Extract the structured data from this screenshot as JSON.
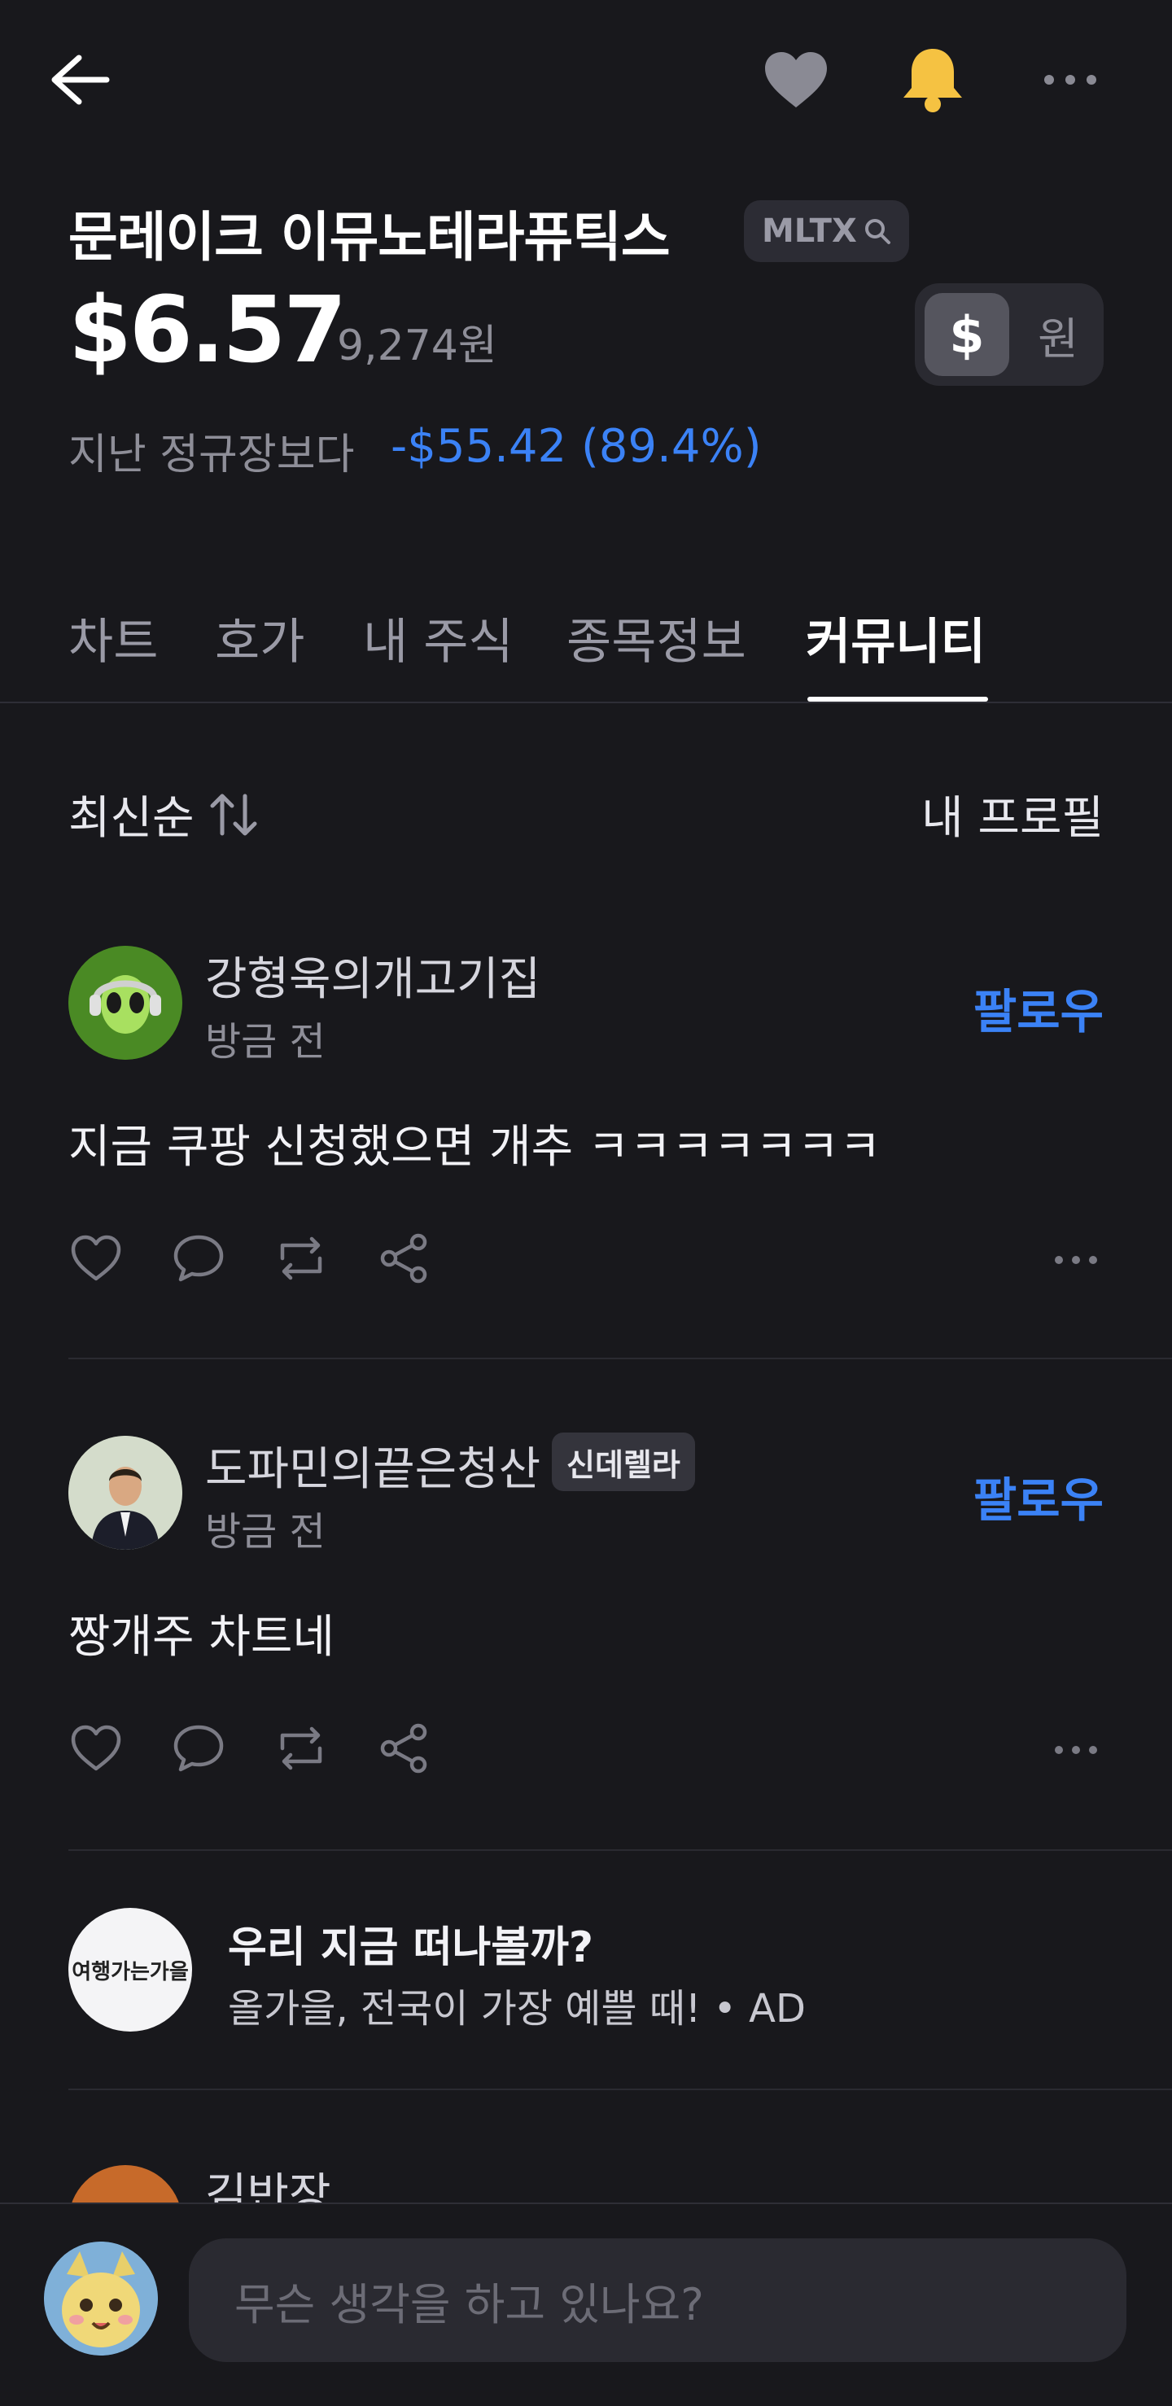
{
  "header": {
    "back_icon": "arrow-left-icon",
    "favorite_icon": "heart-icon",
    "notify_icon": "bell-icon",
    "more_icon": "more-horizontal-icon"
  },
  "stock": {
    "name": "문레이크 이뮤노테라퓨틱스",
    "ticker": "MLTX",
    "price": "$6.57",
    "price_krw": "9,274원",
    "currency_dollar": "$",
    "currency_won": "원",
    "change_label": "지난 정규장보다",
    "change_value": "-$55.42 (89.4%)"
  },
  "tabs": [
    {
      "label": "차트",
      "active": false
    },
    {
      "label": "호가",
      "active": false
    },
    {
      "label": "내 주식",
      "active": false
    },
    {
      "label": "종목정보",
      "active": false
    },
    {
      "label": "커뮤니티",
      "active": true
    }
  ],
  "sort": {
    "label": "최신순",
    "profile_link": "내 프로필"
  },
  "posts": [
    {
      "username": "강형욱의개고기집",
      "time": "방금 전",
      "follow": "팔로우",
      "content": "지금 쿠팡 신청했으면 개추 ㅋㅋㅋㅋㅋㅋㅋ"
    },
    {
      "username": "도파민의끝은청산",
      "badge": "신데렐라",
      "time": "방금 전",
      "follow": "팔로우",
      "content": "짱개주 차트네"
    },
    {
      "username": "김반장"
    }
  ],
  "ad": {
    "logo_text": "여행가는가을",
    "title": "우리 지금 떠나볼까?",
    "subtitle": "올가을, 전국이 가장 예쁠 때! • AD"
  },
  "composer": {
    "placeholder": "무슨 생각을 하고 있나요?"
  },
  "colors": {
    "background": "#18181c",
    "accent_blue": "#3b82f6",
    "bell_yellow": "#f5c242"
  }
}
